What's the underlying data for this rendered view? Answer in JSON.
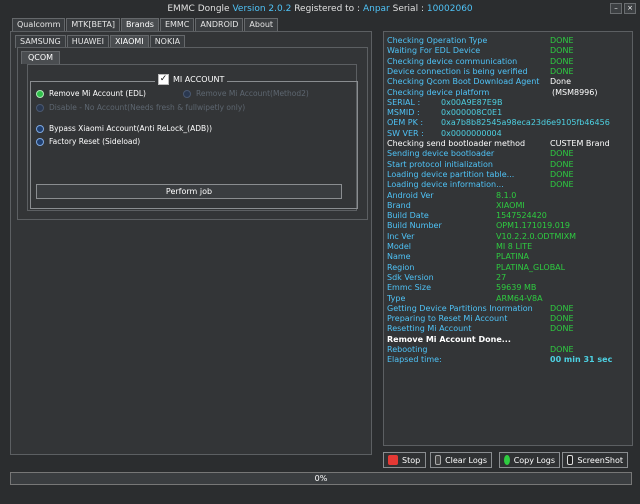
{
  "title": {
    "app": "EMMC Dongle ",
    "version": "Version 2.0.2",
    "reg_label": " Registered to : ",
    "user": "Anpar",
    "serial_label": " Serial : ",
    "serial": "10002060"
  },
  "top_tabs": [
    "Qualcomm",
    "MTK[BETA]",
    "Brands",
    "EMMC",
    "ANDROID",
    "About"
  ],
  "brand_tabs": [
    "SAMSUNG",
    "HUAWEI",
    "XIAOMI",
    "NOKIA"
  ],
  "sub_tab": "QCOM",
  "group": {
    "label": "MI ACCOUNT",
    "checked": "✓"
  },
  "options": [
    "Remove Mi Account (EDL)",
    "Remove Mi Account(Method2)",
    "Disable - No Account(Needs fresh & fullwipetly only)",
    "Bypass Xiaomi Account(Anti ReLock_(ADB))",
    "Factory Reset (Sideload)"
  ],
  "perform_label": "Perform job",
  "log": [
    {
      "label": "Checking Operation Type",
      "value": "DONE"
    },
    {
      "label": "Waiting For EDL Device",
      "value": "DONE"
    },
    {
      "label": "Checking device communication",
      "value": "DONE"
    },
    {
      "label": "Device connection is being verified",
      "value": "DONE"
    },
    {
      "label": "Checking Qcom Boot Download Agent",
      "value": "Done"
    },
    {
      "label": "Checking device platform",
      "value": "(MSM8996)"
    },
    {
      "label": "SERIAL :",
      "value": "0x00A9E87E9B"
    },
    {
      "label": "MSMID :",
      "value": "0x000008C0E1"
    },
    {
      "label": "OEM PK :",
      "value": "0xa7b8b82545a98eca23d6e9105fb46456"
    },
    {
      "label": "SW VER :",
      "value": "0x0000000004"
    },
    {
      "label": "Checking send bootloader method",
      "value": "CUSTEM Brand"
    },
    {
      "label": "Sending device bootloader",
      "value": "DONE"
    },
    {
      "label": "Start protocol initialization",
      "value": "DONE"
    },
    {
      "label": "Loading device partition table...",
      "value": "DONE"
    },
    {
      "label": "Loading device information...",
      "value": "DONE"
    },
    {
      "label": "Android Ver",
      "value": "8.1.0"
    },
    {
      "label": "Brand",
      "value": "XIAOMI"
    },
    {
      "label": "Build Date",
      "value": "1547524420"
    },
    {
      "label": "Build Number",
      "value": "OPM1.171019.019"
    },
    {
      "label": "Inc Ver",
      "value": "V10.2.2.0.ODTMIXM"
    },
    {
      "label": "Model",
      "value": "MI 8 LITE"
    },
    {
      "label": "Name",
      "value": "PLATINA"
    },
    {
      "label": "Region",
      "value": "PLATINA_GLOBAL"
    },
    {
      "label": "Sdk Version",
      "value": "27"
    },
    {
      "label": "Emmc Size",
      "value": "59639 MB"
    },
    {
      "label": "Type",
      "value": "ARM64-V8A"
    },
    {
      "label": "Getting Device Partitions Inormation",
      "value": "DONE"
    },
    {
      "label": "Preparing to Reset Mi Account",
      "value": "DONE"
    },
    {
      "label": "Resetting Mi Account",
      "value": "DONE"
    },
    {
      "label": "Remove Mi Account Done...",
      "value": ""
    },
    {
      "label": "Rebooting",
      "value": "DONE"
    },
    {
      "label": "Elapsed time:",
      "value": "00 min  31 sec"
    }
  ],
  "buttons": {
    "stop": "Stop",
    "clear": "Clear Logs",
    "copy": "Copy Logs",
    "screenshot": "ScreenShot"
  },
  "progress": "0%",
  "colors": {
    "done": "#2ecc40",
    "info": "#4dd0e1",
    "label": "#4fc3f7",
    "white": "#ffffff",
    "stop_red": "#e53935"
  }
}
